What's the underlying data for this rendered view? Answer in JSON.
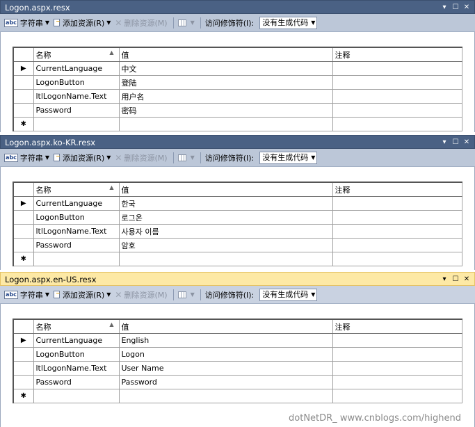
{
  "toolbar": {
    "strings_label": "字符串",
    "add_resource_label": "添加资源(R)",
    "delete_resource_label": "删除资源(M)",
    "access_modifier_label": "访问修饰符(I):",
    "access_modifier_value": "没有生成代码"
  },
  "grid_headers": {
    "name": "名称",
    "value": "值",
    "comment": "注释"
  },
  "panels": [
    {
      "title": "Logon.aspx.resx",
      "rows": [
        {
          "name": "CurrentLanguage",
          "value": "中文",
          "comment": ""
        },
        {
          "name": "LogonButton",
          "value": "登陆",
          "comment": ""
        },
        {
          "name": "ltlLogonName.Text",
          "value": "用户名",
          "comment": ""
        },
        {
          "name": "Password",
          "value": "密码",
          "comment": ""
        }
      ]
    },
    {
      "title": "Logon.aspx.ko-KR.resx",
      "rows": [
        {
          "name": "CurrentLanguage",
          "value": "한국",
          "comment": ""
        },
        {
          "name": "LogonButton",
          "value": "로그온",
          "comment": ""
        },
        {
          "name": "ltlLogonName.Text",
          "value": "사용자 이름",
          "comment": ""
        },
        {
          "name": "Password",
          "value": "암호",
          "comment": ""
        }
      ]
    },
    {
      "title": "Logon.aspx.en-US.resx",
      "rows": [
        {
          "name": "CurrentLanguage",
          "value": "English",
          "comment": ""
        },
        {
          "name": "LogonButton",
          "value": "Logon",
          "comment": ""
        },
        {
          "name": "ltlLogonName.Text",
          "value": "User Name",
          "comment": ""
        },
        {
          "name": "Password",
          "value": "Password",
          "comment": ""
        }
      ]
    }
  ],
  "row_selected_marker": "▶",
  "new_row_marker": "✱",
  "watermark": "dotNetDR_ www.cnblogs.com/highend",
  "icons": [
    "abc-strings-icon",
    "add-resource-icon",
    "delete-x-icon",
    "grid-view-icon",
    "dropdown-arrow-icon",
    "pin-icon",
    "maximize-icon",
    "close-icon"
  ],
  "colors": {
    "inactive_title": "#4a6184",
    "active_title": "#fde9a5",
    "toolbar": "#bcc7d8"
  }
}
